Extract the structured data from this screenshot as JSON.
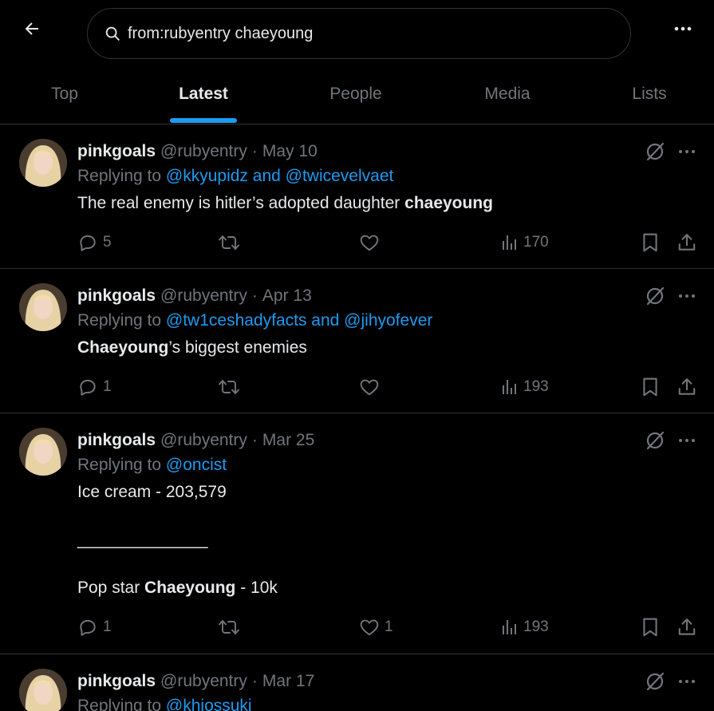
{
  "search": {
    "query": "from:rubyentry chaeyoung"
  },
  "tabs": [
    {
      "label": "Top"
    },
    {
      "label": "Latest"
    },
    {
      "label": "People"
    },
    {
      "label": "Media"
    },
    {
      "label": "Lists"
    }
  ],
  "active_tab": "Latest",
  "colors": {
    "background": "#000000",
    "accent": "#1d9bf0",
    "muted": "#71767b",
    "text": "#e7e9ea",
    "border": "#2f3336"
  },
  "icons": [
    "back-arrow-icon",
    "search-icon",
    "more-icon",
    "grok-icon",
    "reply-icon",
    "retweet-icon",
    "like-icon",
    "views-icon",
    "bookmark-icon",
    "share-icon"
  ],
  "tweets": [
    {
      "name": "pinkgoals",
      "handle": "@rubyentry",
      "dot": "·",
      "date": "May 10",
      "reply_prefix": "Replying to ",
      "reply_mentions": "@kkyupidz and @twicevelvaet",
      "text_a": "The real enemy is hitler’s adopted daughter ",
      "text_bold": "chaeyoung",
      "text_b": "",
      "replies": "5",
      "retweets": "",
      "likes": "",
      "views": "170"
    },
    {
      "name": "pinkgoals",
      "handle": "@rubyentry",
      "dot": "·",
      "date": "Apr 13",
      "reply_prefix": "Replying to ",
      "reply_mentions": "@tw1ceshadyfacts and @jihyofever",
      "text_a": "",
      "text_bold": "Chaeyoung",
      "text_b": "’s biggest enemies",
      "replies": "1",
      "retweets": "",
      "likes": "",
      "views": "193"
    },
    {
      "name": "pinkgoals",
      "handle": "@rubyentry",
      "dot": "·",
      "date": "Mar 25",
      "reply_prefix": "Replying to ",
      "reply_mentions": "@oncist",
      "line1": "Ice cream - 203,579",
      "line2": "______________",
      "line3_a": "Pop star ",
      "line3_bold": "Chaeyoung",
      "line3_b": " - 10k",
      "replies": "1",
      "retweets": "",
      "likes": "1",
      "views": "193"
    },
    {
      "name": "pinkgoals",
      "handle": "@rubyentry",
      "dot": "·",
      "date": "Mar 17",
      "reply_prefix": "Replying to ",
      "reply_mentions": "@khiossuki"
    }
  ]
}
